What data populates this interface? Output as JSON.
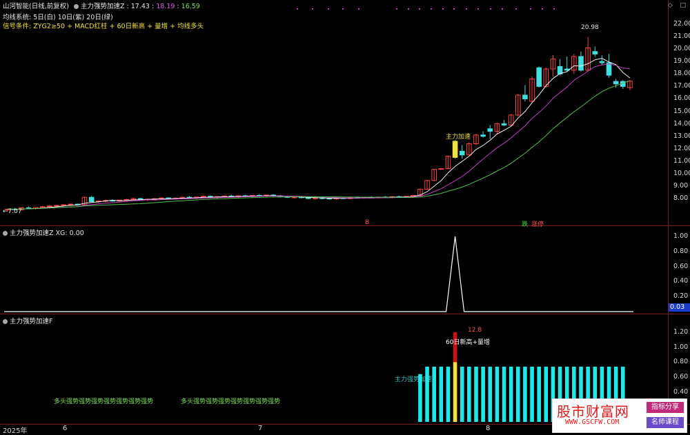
{
  "main_panel": {
    "stock": "山河智能",
    "mode": "(日线,前复权)",
    "indicator_name": "主力强势加速Z",
    "indicator_values": [
      "17.43",
      "18.19",
      "16.59"
    ],
    "line1_label": "均线系统:",
    "line1_text": "5日(白) 10日(紫) 20日(绿)",
    "line2_label": "信号条件:",
    "line2_text": "ZYG2≥50 + MACD红柱 + 60日新高 + 量增 + 均线多头",
    "high_label": "20.98",
    "low_label": "7.07",
    "signal_text": "主力加速",
    "tag_b": "B",
    "tag_die": "跌",
    "tag_zhangting": "涨停",
    "y_ticks": [
      "22.00",
      "21.00",
      "20.00",
      "19.00",
      "18.00",
      "17.00",
      "16.00",
      "15.00",
      "14.00",
      "13.00",
      "12.00",
      "11.00",
      "10.00",
      "9.00",
      "8.00"
    ]
  },
  "panel2": {
    "title": "主力强势加速Z",
    "xg_label": "XG:",
    "xg_value": "0.00",
    "y_ticks": [
      "1.00",
      "0.80",
      "0.60",
      "0.40",
      "0.20"
    ],
    "current_badge": "0.03"
  },
  "panel3": {
    "title": "主力强势加速F",
    "label_60": "60日新高+量增",
    "label_value": "12.8",
    "text_duotou": "多头强势强势强势强势强势强势强势",
    "text_duotou2": "多头强势强势强势强势强势强势强势",
    "text_strong": "主力强势加速",
    "y_ticks": [
      "1.20",
      "1.00",
      "0.80",
      "0.60",
      "0.40"
    ]
  },
  "x_axis": {
    "year": "2025年",
    "m6": "6",
    "m7": "7",
    "m8": "8"
  },
  "watermark": {
    "title": "股市财富网",
    "url": "WWW.GSCFW.COM",
    "btn1": "指标分享",
    "btn2": "名师课程"
  },
  "colors": {
    "up": "#ff4040",
    "down": "#40e0e0",
    "ma5": "#f0f0f0",
    "ma10": "#c040c0",
    "ma20": "#50c050",
    "signal": "#f0e040"
  },
  "chart_data": {
    "type": "candlestick",
    "y_range": [
      7.0,
      22.0
    ],
    "candles": [
      [
        7.1,
        7.2,
        7.0,
        7.15
      ],
      [
        7.15,
        7.25,
        7.05,
        7.1
      ],
      [
        7.1,
        7.3,
        7.05,
        7.25
      ],
      [
        7.25,
        7.35,
        7.15,
        7.2
      ],
      [
        7.2,
        7.3,
        7.1,
        7.28
      ],
      [
        7.28,
        7.4,
        7.2,
        7.35
      ],
      [
        7.35,
        7.45,
        7.25,
        7.4
      ],
      [
        7.4,
        7.5,
        7.3,
        7.45
      ],
      [
        7.45,
        7.55,
        7.35,
        7.5
      ],
      [
        7.5,
        7.6,
        7.4,
        7.55
      ],
      [
        7.55,
        7.6,
        7.45,
        7.5
      ],
      [
        7.5,
        8.15,
        7.5,
        8.1
      ],
      [
        8.1,
        8.2,
        7.7,
        7.75
      ],
      [
        7.75,
        7.85,
        7.65,
        7.8
      ],
      [
        7.8,
        7.9,
        7.7,
        7.85
      ],
      [
        7.85,
        7.95,
        7.75,
        7.8
      ],
      [
        7.8,
        7.9,
        7.7,
        7.88
      ],
      [
        7.88,
        7.98,
        7.8,
        7.92
      ],
      [
        7.92,
        8.05,
        7.85,
        8.0
      ],
      [
        8.0,
        8.05,
        7.85,
        7.9
      ],
      [
        7.9,
        8.0,
        7.8,
        7.95
      ],
      [
        7.95,
        8.05,
        7.85,
        7.98
      ],
      [
        7.98,
        8.1,
        7.9,
        8.05
      ],
      [
        8.05,
        8.1,
        7.95,
        8.0
      ],
      [
        8.0,
        8.1,
        7.92,
        8.02
      ],
      [
        8.02,
        8.15,
        7.95,
        8.1
      ],
      [
        8.1,
        8.2,
        8.0,
        8.05
      ],
      [
        8.05,
        8.15,
        7.95,
        8.12
      ],
      [
        8.12,
        8.25,
        8.05,
        8.18
      ],
      [
        8.18,
        8.25,
        8.05,
        8.1
      ],
      [
        8.1,
        8.2,
        8.0,
        8.15
      ],
      [
        8.15,
        8.25,
        8.05,
        8.2
      ],
      [
        8.2,
        8.3,
        8.1,
        8.15
      ],
      [
        8.15,
        8.25,
        8.05,
        8.22
      ],
      [
        8.22,
        8.3,
        8.1,
        8.18
      ],
      [
        8.18,
        8.28,
        8.1,
        8.25
      ],
      [
        8.25,
        8.35,
        8.15,
        8.2
      ],
      [
        8.2,
        8.3,
        8.1,
        8.28
      ],
      [
        8.28,
        8.35,
        8.15,
        8.2
      ],
      [
        8.2,
        8.28,
        8.1,
        8.15
      ],
      [
        8.15,
        8.22,
        8.05,
        8.1
      ],
      [
        8.1,
        8.18,
        8.0,
        8.12
      ],
      [
        8.12,
        8.2,
        8.02,
        8.08
      ],
      [
        8.08,
        8.15,
        7.95,
        8.0
      ],
      [
        8.0,
        8.1,
        7.9,
        8.05
      ],
      [
        8.05,
        8.12,
        7.95,
        8.02
      ],
      [
        8.02,
        8.1,
        7.92,
        7.98
      ],
      [
        7.98,
        8.08,
        7.9,
        8.05
      ],
      [
        8.05,
        8.12,
        7.98,
        8.0
      ],
      [
        8.0,
        8.1,
        7.95,
        8.08
      ],
      [
        8.08,
        8.15,
        8.0,
        8.05
      ],
      [
        8.05,
        8.12,
        7.98,
        8.1
      ],
      [
        8.1,
        8.18,
        8.02,
        8.08
      ],
      [
        8.08,
        8.15,
        8.0,
        8.12
      ],
      [
        8.12,
        8.2,
        8.05,
        8.1
      ],
      [
        8.1,
        8.18,
        8.02,
        8.15
      ],
      [
        8.15,
        8.22,
        8.08,
        8.12
      ],
      [
        8.12,
        8.2,
        8.05,
        8.18
      ],
      [
        8.18,
        8.3,
        8.1,
        8.25
      ],
      [
        8.25,
        8.8,
        8.2,
        8.75
      ],
      [
        8.75,
        9.5,
        8.7,
        9.45
      ],
      [
        9.45,
        10.4,
        9.4,
        10.35
      ],
      [
        10.35,
        10.45,
        10.3,
        10.4
      ],
      [
        10.4,
        11.45,
        10.38,
        11.4
      ],
      [
        12.6,
        12.7,
        11.2,
        11.3
      ],
      [
        11.8,
        12.3,
        11.2,
        11.5
      ],
      [
        11.5,
        12.5,
        11.45,
        12.4
      ],
      [
        12.4,
        13.2,
        12.3,
        13.1
      ],
      [
        13.1,
        13.4,
        12.9,
        13.0
      ],
      [
        13.6,
        13.9,
        12.8,
        13.4
      ],
      [
        13.4,
        14.1,
        13.2,
        14.0
      ],
      [
        14.0,
        14.3,
        13.8,
        13.9
      ],
      [
        13.9,
        14.8,
        13.8,
        14.7
      ],
      [
        14.7,
        16.4,
        14.6,
        16.3
      ],
      [
        16.3,
        17.1,
        15.8,
        16.0
      ],
      [
        15.8,
        17.8,
        15.7,
        17.6
      ],
      [
        18.5,
        18.6,
        16.9,
        17.0
      ],
      [
        17.0,
        18.5,
        16.9,
        18.4
      ],
      [
        18.4,
        19.5,
        17.8,
        19.2
      ],
      [
        18.6,
        19.2,
        17.9,
        18.0
      ],
      [
        18.4,
        19.4,
        18.2,
        18.3
      ],
      [
        18.3,
        19.6,
        18.0,
        19.4
      ],
      [
        19.4,
        19.8,
        18.2,
        18.3
      ],
      [
        18.3,
        20.98,
        18.2,
        20.1
      ],
      [
        19.8,
        20.2,
        19.4,
        19.6
      ],
      [
        19.0,
        19.5,
        18.7,
        18.9
      ],
      [
        18.9,
        19.6,
        17.7,
        17.9
      ],
      [
        17.4,
        17.6,
        16.9,
        17.2
      ],
      [
        17.4,
        17.5,
        16.8,
        17.0
      ],
      [
        16.9,
        17.5,
        16.7,
        17.43
      ]
    ]
  }
}
